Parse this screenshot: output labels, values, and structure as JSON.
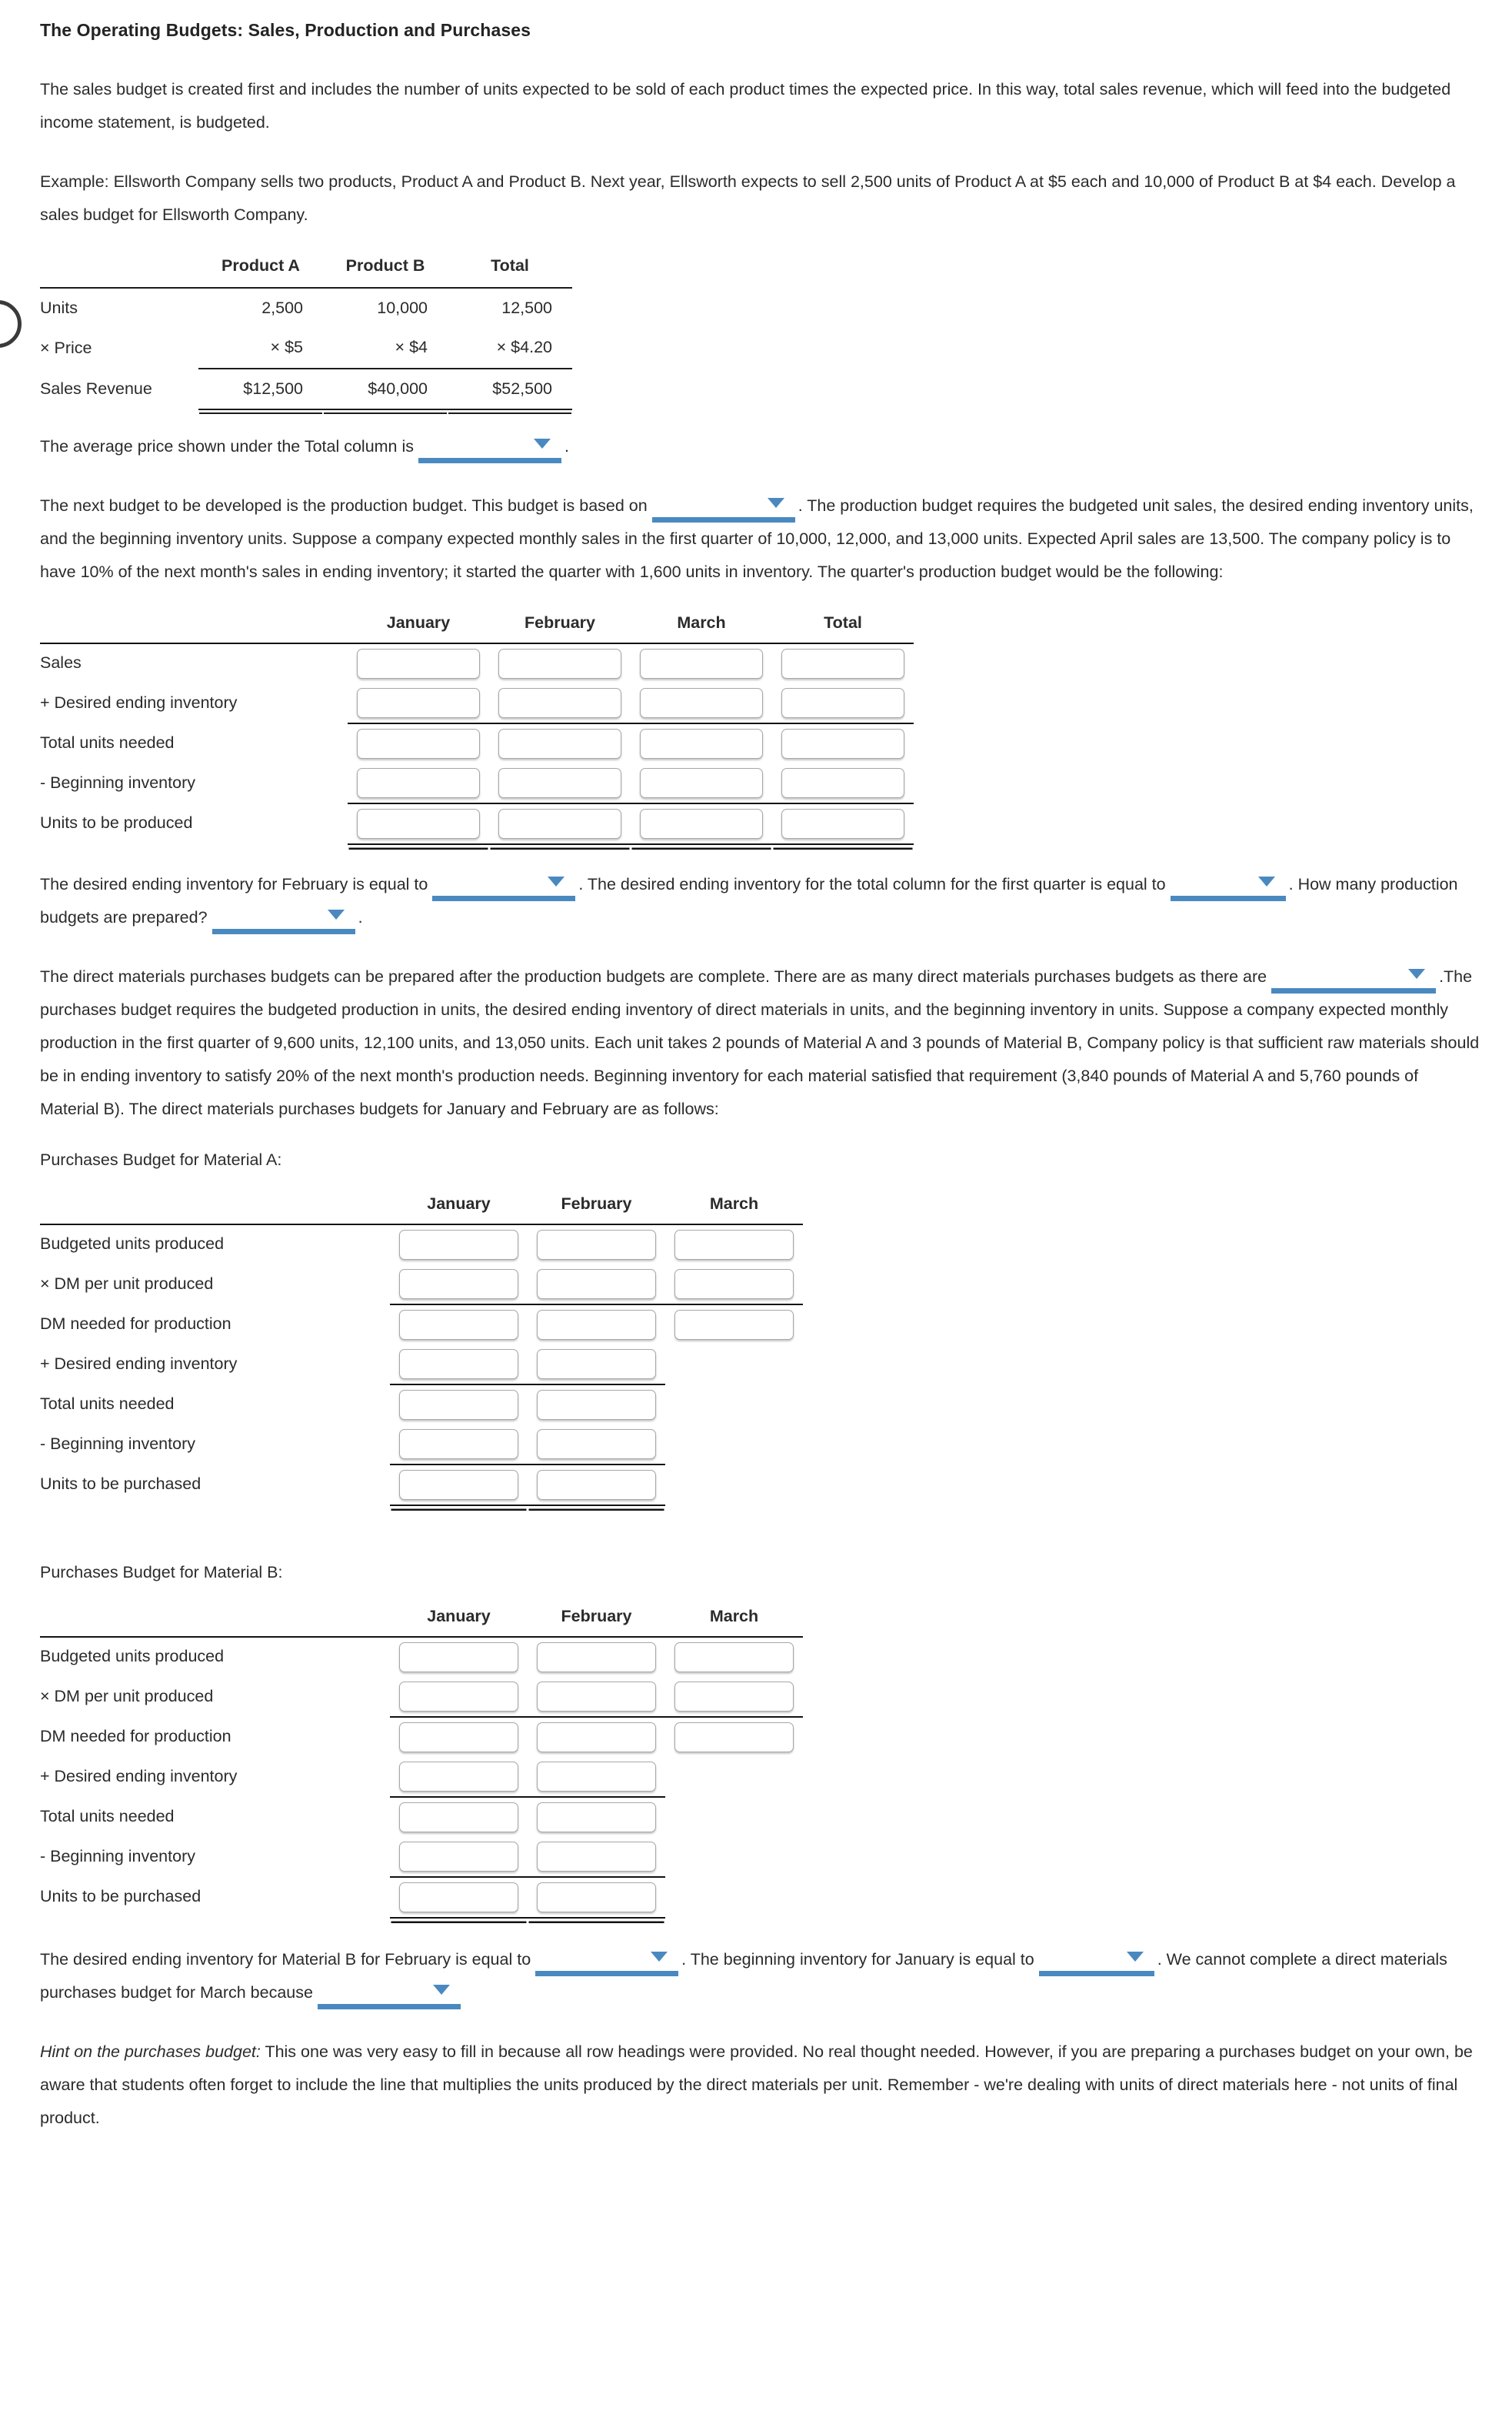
{
  "document": {
    "title": "The Operating Budgets: Sales, Production and Purchases",
    "paragraphs": {
      "intro": "The sales budget is created first and includes the number of units expected to be sold of each product times the expected price. In this way, total sales revenue, which will feed into the budgeted income statement, is budgeted.",
      "example": "Example: Ellsworth Company sells two products, Product A and Product B. Next year, Ellsworth expects to sell 2,500 units of Product A at $5 each and 10,000 of Product B at $4 each. Develop a sales budget for Ellsworth Company.",
      "avg_price_prefix": "The average price shown under the Total column is",
      "avg_price_suffix": ".",
      "production_intro_a": "The next budget to be developed is the production budget. This budget is based on",
      "production_intro_b": ". The production budget requires the budgeted unit sales, the desired ending inventory units, and the beginning inventory units. Suppose a company expected monthly sales in the first quarter of 10,000, 12,000, and 13,000 units. Expected April sales are 13,500. The company policy is to have 10% of the next month's sales in ending inventory; it started the quarter with 1,600 units in inventory. The quarter's production budget would be the following:",
      "desired_ei_a": "The desired ending inventory for February is equal to",
      "desired_ei_b": ". The desired ending inventory for the total column for the first quarter is equal to",
      "desired_ei_c": ". How many production budgets are prepared?",
      "desired_ei_d": ".",
      "purchases_intro_a": "The direct materials purchases budgets can be prepared after the production budgets are complete. There are as many direct materials purchases budgets as there are",
      "purchases_intro_b": ".The purchases budget requires the budgeted production in units, the desired ending inventory of direct materials in units, and the beginning inventory in units. Suppose a company expected monthly production in the first quarter of 9,600 units, 12,100 units, and 13,050 units. Each unit takes 2 pounds of Material A and 3 pounds of Material B, Company policy is that sufficient raw materials should be in ending inventory to satisfy 20% of the next month's production needs. Beginning inventory for each material satisfied that requirement (3,840 pounds of Material A and 5,760 pounds of Material B). The direct materials purchases budgets for January and February are as follows:",
      "final_q_a": "The desired ending inventory for Material B for February is equal to",
      "final_q_b": ". The beginning inventory for January is equal to",
      "final_q_c": ". We cannot complete a direct materials purchases budget for March because",
      "final_q_d": "",
      "hint_label": "Hint on the purchases budget:",
      "hint_body": " This one was very easy to fill in because all row headings were provided. No real thought needed. However, if you are preparing a purchases budget on your own, be aware that students often forget to include the line that multiplies the units produced by the direct materials per unit. Remember - we're dealing with units of direct materials here - not units of final product."
    },
    "sales_budget": {
      "columns": [
        "Product A",
        "Product B",
        "Total"
      ],
      "rows": [
        {
          "label": "Units",
          "values": [
            "2,500",
            "10,000",
            "12,500"
          ]
        },
        {
          "label": "× Price",
          "values": [
            "× $5",
            "× $4",
            "× $4.20"
          ]
        },
        {
          "label": "Sales Revenue",
          "values": [
            "$12,500",
            "$40,000",
            "$52,500"
          ]
        }
      ]
    },
    "production_budget": {
      "columns": [
        "January",
        "February",
        "March",
        "Total"
      ],
      "rows": [
        {
          "label": "Sales",
          "values": [
            "",
            "",
            "",
            ""
          ]
        },
        {
          "label": "+ Desired ending inventory",
          "values": [
            "",
            "",
            "",
            ""
          ]
        },
        {
          "label": "Total units needed",
          "values": [
            "",
            "",
            "",
            ""
          ]
        },
        {
          "label": "- Beginning inventory",
          "values": [
            "",
            "",
            "",
            ""
          ]
        },
        {
          "label": "Units to be produced",
          "values": [
            "",
            "",
            "",
            ""
          ]
        }
      ]
    },
    "material_a_budget": {
      "caption": "Purchases Budget for Material A:",
      "columns": [
        "January",
        "February",
        "March"
      ],
      "rows": [
        {
          "label": "Budgeted units produced",
          "values": [
            "",
            "",
            ""
          ]
        },
        {
          "label": "× DM per unit produced",
          "values": [
            "",
            "",
            ""
          ]
        },
        {
          "label": "DM needed for production",
          "values": [
            "",
            "",
            ""
          ]
        },
        {
          "label": "+ Desired ending inventory",
          "values": [
            "",
            ""
          ]
        },
        {
          "label": "Total units needed",
          "values": [
            "",
            ""
          ]
        },
        {
          "label": "- Beginning inventory",
          "values": [
            "",
            ""
          ]
        },
        {
          "label": "Units to be purchased",
          "values": [
            "",
            ""
          ]
        }
      ]
    },
    "material_b_budget": {
      "caption": "Purchases Budget for Material B:",
      "columns": [
        "January",
        "February",
        "March"
      ],
      "rows": [
        {
          "label": "Budgeted units produced",
          "values": [
            "",
            "",
            ""
          ]
        },
        {
          "label": "× DM per unit produced",
          "values": [
            "",
            "",
            ""
          ]
        },
        {
          "label": "DM needed for production",
          "values": [
            "",
            "",
            ""
          ]
        },
        {
          "label": "+ Desired ending inventory",
          "values": [
            "",
            ""
          ]
        },
        {
          "label": "Total units needed",
          "values": [
            "",
            ""
          ]
        },
        {
          "label": "- Beginning inventory",
          "values": [
            "",
            ""
          ]
        },
        {
          "label": "Units to be purchased",
          "values": [
            "",
            ""
          ]
        }
      ]
    },
    "dropdowns": {
      "avg_price": "",
      "production_basis": "",
      "desired_ei_feb": "",
      "desired_ei_total": "",
      "how_many_budgets": "",
      "as_there_are": "",
      "matb_ei_feb": "",
      "beginning_jan": "",
      "march_reason": ""
    },
    "colors": {
      "dropdown_blue": "#4a89c0",
      "rule_black": "#121212",
      "input_border": "#a7a7a7",
      "text": "#2b2b2b"
    },
    "icons": {
      "dropdown_caret": "caret-down-icon"
    }
  }
}
